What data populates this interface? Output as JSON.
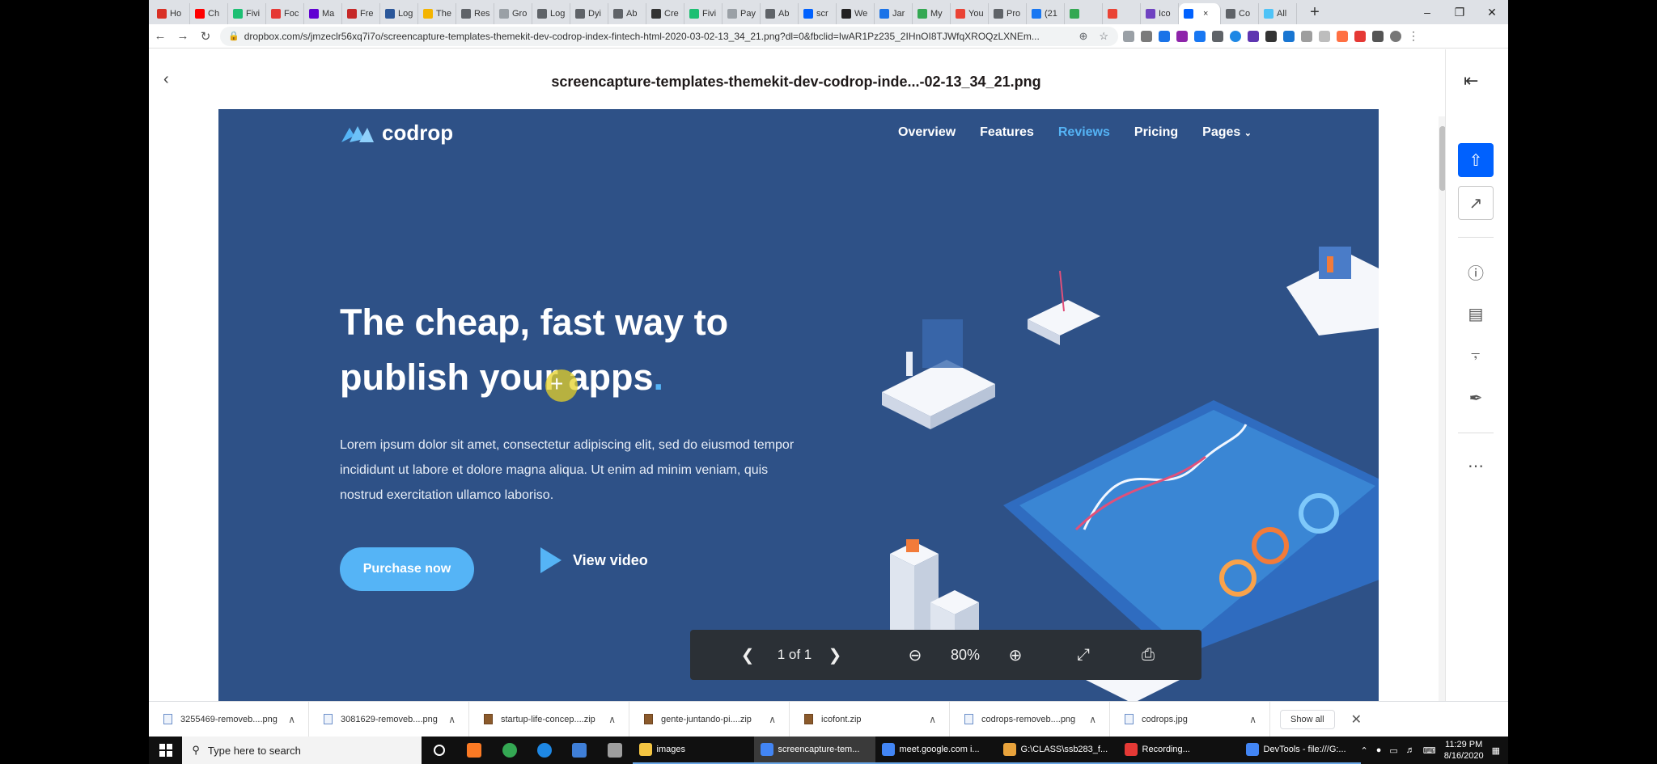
{
  "browser": {
    "tabs": [
      {
        "label": "Ho",
        "color": "#d93025"
      },
      {
        "label": "Ch",
        "color": "#ff0000"
      },
      {
        "label": "Fivi",
        "color": "#1dbf73"
      },
      {
        "label": "Foc",
        "color": "#e53935"
      },
      {
        "label": "Ma",
        "color": "#6001d2"
      },
      {
        "label": "Fre",
        "color": "#c62828"
      },
      {
        "label": "Log",
        "color": "#2b579a"
      },
      {
        "label": "The",
        "color": "#f4b400"
      },
      {
        "label": "Res",
        "color": "#5f6368"
      },
      {
        "label": "Gro",
        "color": "#9aa0a6"
      },
      {
        "label": "Log",
        "color": "#5f6368"
      },
      {
        "label": "Dyi",
        "color": "#5f6368"
      },
      {
        "label": "Ab",
        "color": "#5f6368"
      },
      {
        "label": "Cre",
        "color": "#333333"
      },
      {
        "label": "Fivi",
        "color": "#1dbf73"
      },
      {
        "label": "Pay",
        "color": "#9aa0a6"
      },
      {
        "label": "Ab",
        "color": "#5f6368"
      },
      {
        "label": "scr",
        "color": "#0061fe"
      },
      {
        "label": "We",
        "color": "#222222"
      },
      {
        "label": "Jar",
        "color": "#1a73e8"
      },
      {
        "label": "My",
        "color": "#34a853"
      },
      {
        "label": "You",
        "color": "#ea4335"
      },
      {
        "label": "Pro",
        "color": "#5f6368"
      },
      {
        "label": "(21",
        "color": "#1877f2"
      },
      {
        "label": "",
        "color": "#34a853"
      },
      {
        "label": "",
        "color": "#ea4335"
      },
      {
        "label": "Ico",
        "color": "#6f42c1"
      },
      {
        "label": "",
        "color": "#0061fe",
        "active": true
      },
      {
        "label": "Co",
        "color": "#5f6368"
      },
      {
        "label": "All",
        "color": "#4fc3f7"
      }
    ],
    "url": "dropbox.com/s/jmzeclr56xq7i7o/screencapture-templates-themekit-dev-codrop-index-fintech-html-2020-03-02-13_34_21.png?dl=0&fbclid=IwAR1Pz235_2IHnOI8TJWfqXROQzLXNEm..."
  },
  "viewer": {
    "filename": "screencapture-templates-themekit-dev-codrop-inde...-02-13_34_21.png",
    "page_indicator": "1 of 1",
    "zoom": "80%"
  },
  "preview": {
    "logo_text": "codrop",
    "nav": [
      "Overview",
      "Features",
      "Reviews",
      "Pricing",
      "Pages"
    ],
    "active_nav": "Reviews",
    "headline_line1": "The cheap, fast way to",
    "headline_line2": "publish your apps",
    "headline_dot": ".",
    "lead": "Lorem ipsum dolor sit amet, consectetur adipiscing elit, sed do eiusmod tempor incididunt ut labore et dolore magna aliqua. Ut enim ad minim veniam, quis nostrud exercitation ullamco laboriso.",
    "purchase_label": "Purchase now",
    "video_label": "View video",
    "accent": "#55b4f6",
    "background": "#2e5187"
  },
  "downloads": {
    "items": [
      {
        "name": "3255469-removeb....png",
        "type": "png"
      },
      {
        "name": "3081629-removeb....png",
        "type": "png"
      },
      {
        "name": "startup-life-concep....zip",
        "type": "zip"
      },
      {
        "name": "gente-juntando-pi....zip",
        "type": "zip"
      },
      {
        "name": "icofont.zip",
        "type": "zip"
      },
      {
        "name": "codrops-removeb....png",
        "type": "png"
      },
      {
        "name": "codrops.jpg",
        "type": "png"
      }
    ],
    "show_all": "Show all"
  },
  "taskbar": {
    "search_placeholder": "Type here to search",
    "apps": [
      {
        "label": "images",
        "color": "#f4c542"
      },
      {
        "label": "screencapture-tem...",
        "color": "#4285f4",
        "active": true
      },
      {
        "label": "meet.google.com i...",
        "color": "#4285f4"
      },
      {
        "label": "G:\\CLASS\\ssb283_f...",
        "color": "#e8a33c"
      },
      {
        "label": "Recording...",
        "color": "#e53935"
      },
      {
        "label": "DevTools - file:///G:...",
        "color": "#4285f4"
      }
    ],
    "time": "11:29 PM",
    "date": "8/16/2020"
  }
}
